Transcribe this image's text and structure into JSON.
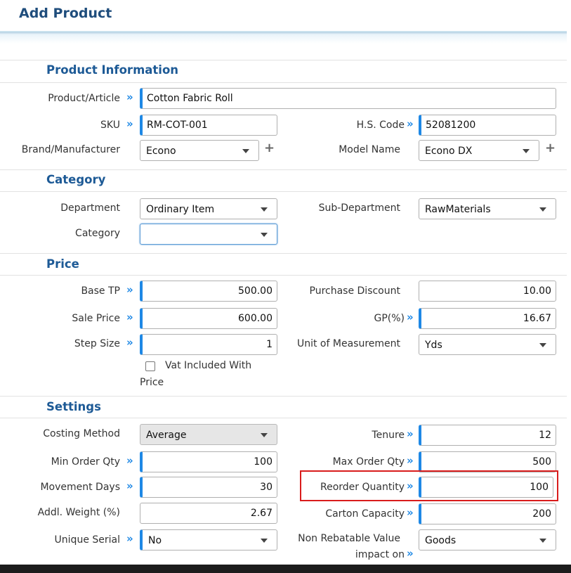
{
  "page": {
    "title": "Add Product"
  },
  "sections": {
    "product_info": "Product Information",
    "category": "Category",
    "price": "Price",
    "settings": "Settings"
  },
  "product": {
    "name_label": "Product/Article",
    "name_value": "Cotton Fabric Roll",
    "sku_label": "SKU",
    "sku_value": "RM-COT-001",
    "hs_label": "H.S. Code",
    "hs_value": "52081200",
    "brand_label": "Brand/Manufacturer",
    "brand_value": "Econo",
    "model_label": "Model Name",
    "model_value": "Econo DX"
  },
  "category": {
    "department_label": "Department",
    "department_value": "Ordinary Item",
    "subdept_label": "Sub-Department",
    "subdept_value": "RawMaterials",
    "category_label": "Category",
    "category_value": ""
  },
  "price": {
    "base_tp_label": "Base TP",
    "base_tp_value": "500.00",
    "purchase_discount_label": "Purchase Discount",
    "purchase_discount_value": "10.00",
    "sale_price_label": "Sale Price",
    "sale_price_value": "600.00",
    "gp_label": "GP(%)",
    "gp_value": "16.67",
    "step_size_label": "Step Size",
    "step_size_value": "1",
    "uom_label": "Unit of Measurement",
    "uom_value": "Yds",
    "vat_line1": "Vat Included With",
    "vat_line2": "Price",
    "vat_checked": false
  },
  "settings": {
    "costing_label": "Costing Method",
    "costing_value": "Average",
    "tenure_label": "Tenure",
    "tenure_value": "12",
    "min_order_label": "Min Order Qty",
    "min_order_value": "100",
    "max_order_label": "Max Order Qty",
    "max_order_value": "500",
    "movement_label": "Movement Days",
    "movement_value": "30",
    "reorder_label": "Reorder Quantity",
    "reorder_value": "100",
    "addl_weight_label": "Addl. Weight (%)",
    "addl_weight_value": "2.67",
    "carton_label": "Carton Capacity",
    "carton_value": "200",
    "unique_serial_label": "Unique Serial",
    "unique_serial_value": "No",
    "nrv_line1": "Non Rebatable Value",
    "nrv_line2": "impact on",
    "nrv_value": "Goods"
  },
  "icons": {
    "required": "double-chevron-right-icon",
    "add": "plus-icon",
    "dropdown": "caret-down-icon"
  },
  "colors": {
    "accent": "#1e88e5",
    "title": "#1f4d7c",
    "section": "#1d5a96",
    "highlight": "#d91c1c"
  }
}
